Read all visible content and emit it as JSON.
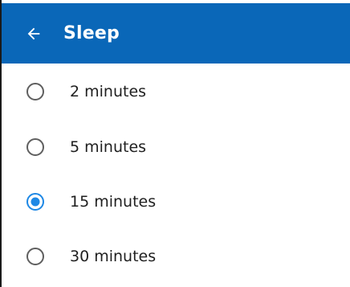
{
  "header": {
    "title": "Sleep",
    "back_icon": "arrow-left-icon",
    "background_color": "#0a67b8"
  },
  "options": [
    {
      "label": "2 minutes",
      "selected": false
    },
    {
      "label": "5 minutes",
      "selected": false
    },
    {
      "label": "15 minutes",
      "selected": true
    },
    {
      "label": "30 minutes",
      "selected": false
    }
  ],
  "colors": {
    "radio_selected": "#1e88e5",
    "radio_unselected": "#5f5f5f",
    "text": "#1f1f1f"
  }
}
